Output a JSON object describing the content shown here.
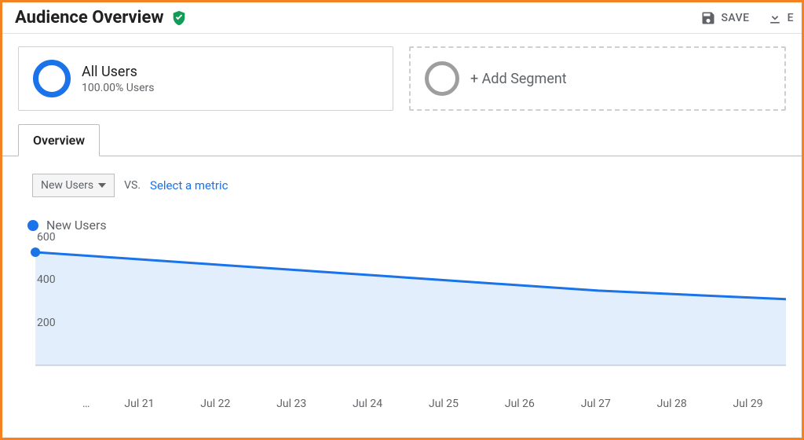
{
  "header": {
    "title": "Audience Overview",
    "actions": {
      "save": "SAVE",
      "export_initial": "E"
    }
  },
  "segments": {
    "primary": {
      "name": "All Users",
      "sub": "100.00% Users"
    },
    "add_label": "+ Add Segment"
  },
  "tabs": {
    "overview": "Overview"
  },
  "metrics": {
    "primary": "New Users",
    "vs": "VS.",
    "select_label": "Select a metric"
  },
  "legend": {
    "series_name": "New Users"
  },
  "colors": {
    "accent": "#1a73e8",
    "muted": "#5f6368",
    "border": "#bdbdbd"
  },
  "chart_data": {
    "type": "line",
    "title": "New Users",
    "x": [
      "Jul 21",
      "Jul 22",
      "Jul 23",
      "Jul 24",
      "Jul 25",
      "Jul 26",
      "Jul 27",
      "Jul 28",
      "Jul 29"
    ],
    "y": [
      530,
      500,
      470,
      440,
      410,
      380,
      350,
      330,
      310
    ],
    "yticks": [
      200,
      400,
      600
    ],
    "ylim": [
      0,
      600
    ],
    "xlabel": "",
    "ylabel": ""
  }
}
